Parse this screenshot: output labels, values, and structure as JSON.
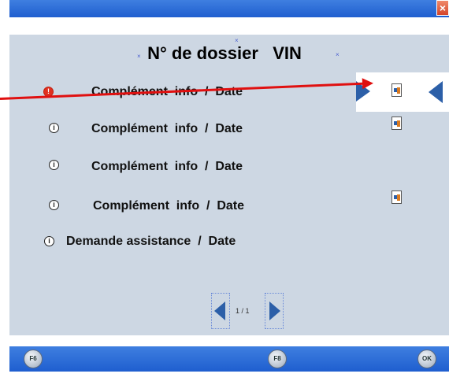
{
  "window": {
    "close_label": "×"
  },
  "dossier": {
    "title": "N° de dossier   VIN"
  },
  "rows": [
    {
      "label": "Complément  info  /  Date",
      "icon": "alert-icon",
      "has_doc": true
    },
    {
      "label": "Complément  info  /  Date",
      "icon": "info-icon",
      "has_doc": true
    },
    {
      "label": "Complément  info  /  Date",
      "icon": "info-icon",
      "has_doc": false
    },
    {
      "label": "Complément  info  /  Date",
      "icon": "info-icon",
      "has_doc": true
    },
    {
      "label": "Demande assistance  /  Date",
      "icon": "info-icon",
      "has_doc": false
    }
  ],
  "pagination": {
    "page_text": "1 / 1"
  },
  "toolbar": {
    "f6_label": "F6",
    "f8_label": "F8",
    "ok_label": "OK"
  },
  "colors": {
    "titlebar": "#2a6ad8",
    "panel": "#cdd7e3",
    "accent_arrow": "#2c5fa8",
    "alert": "#e03020"
  }
}
